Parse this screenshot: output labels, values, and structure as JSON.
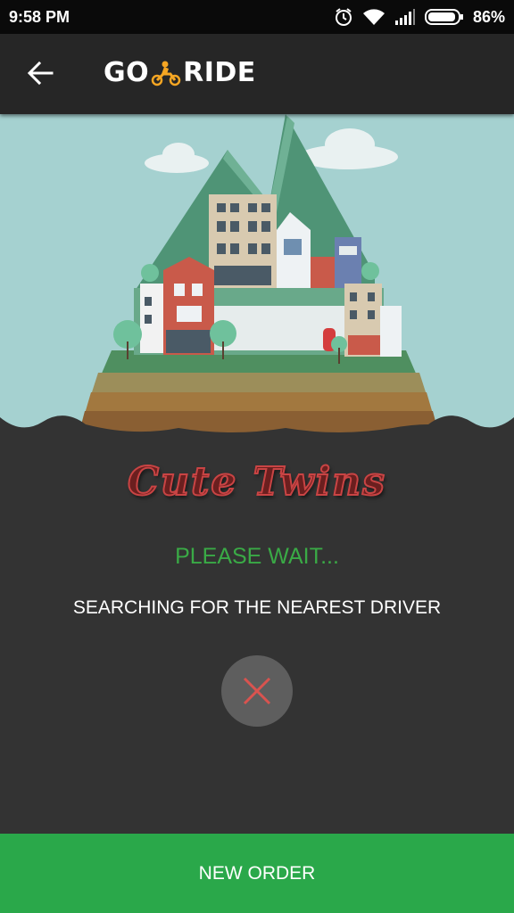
{
  "status_bar": {
    "time": "9:58 PM",
    "battery_percent": "86%",
    "icons": [
      "alarm-icon",
      "wifi-icon",
      "signal-icon",
      "battery-icon"
    ]
  },
  "app_bar": {
    "back_icon": "arrow-left-icon",
    "brand_left": "GO",
    "brand_right": "RIDE",
    "brand_icon": "motorbike-icon",
    "brand_accent": "#f5a623"
  },
  "main": {
    "logo_text": "Cute Twins",
    "wait_text": "PLEASE WAIT...",
    "search_text": "SEARCHING FOR THE NEAREST DRIVER",
    "cancel_icon": "close-icon",
    "cancel_color": "#d9534f"
  },
  "footer": {
    "new_order_label": "NEW ORDER",
    "color": "#2aa84a"
  }
}
